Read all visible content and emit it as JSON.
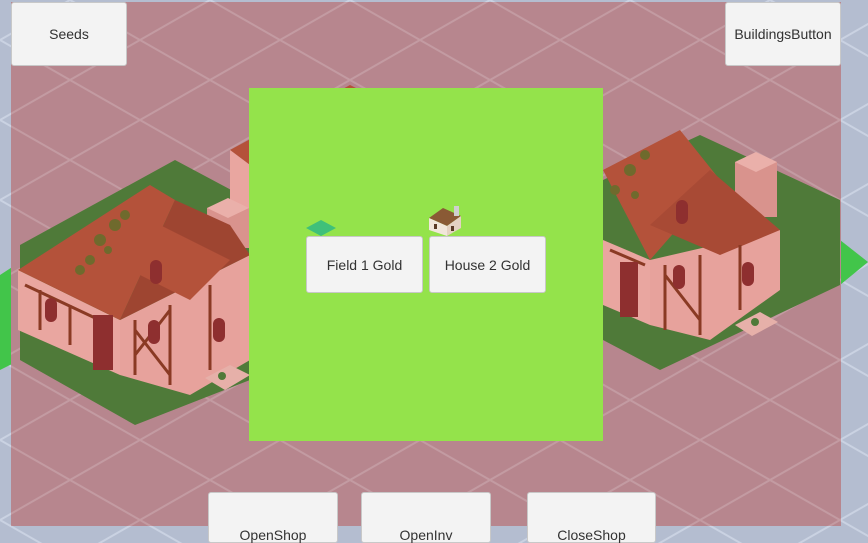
{
  "top_left_button": {
    "label": "Seeds"
  },
  "top_right_button": {
    "label": "BuildingsButton"
  },
  "shop": {
    "items": [
      {
        "label": "Field 1 Gold",
        "icon": "field-tile-icon"
      },
      {
        "label": "House 2 Gold",
        "icon": "house-icon"
      }
    ]
  },
  "bottom_bar": {
    "open_shop_label": "OpenShop",
    "open_inv_label": "OpenInv",
    "close_shop_label": "CloseShop"
  },
  "colors": {
    "overlay": "#b7868e",
    "panel": "#94e34b",
    "grass": "#4f7a39",
    "roof": "#b4523a",
    "wall": "#e9a6a0",
    "timber": "#8a3a24"
  }
}
